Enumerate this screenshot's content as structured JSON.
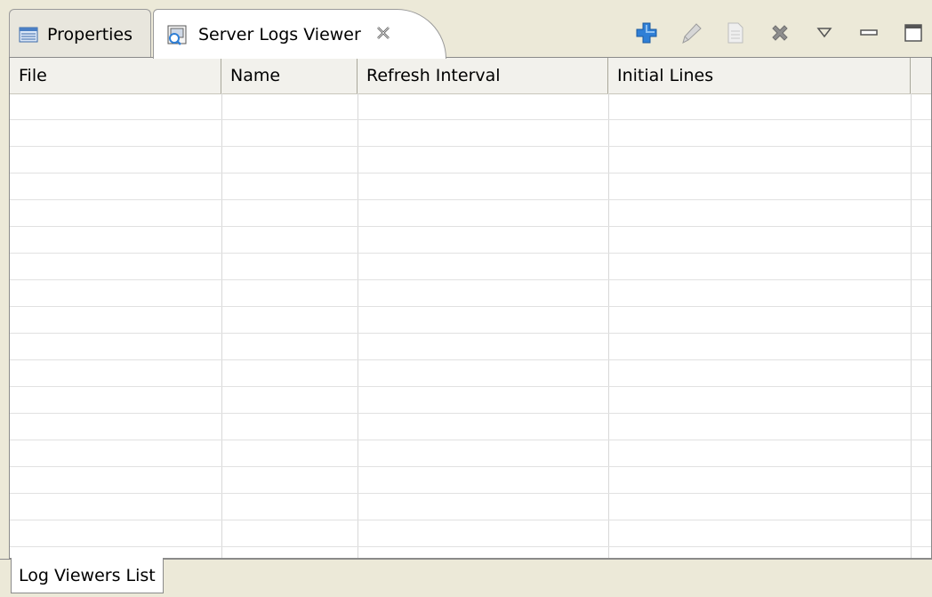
{
  "tabs": {
    "properties": "Properties",
    "active": "Server Logs Viewer"
  },
  "icons": {
    "properties": "properties-icon",
    "server_logs": "server-logs-icon",
    "close": "close-icon",
    "add": "add-icon",
    "edit": "edit-icon",
    "copy": "copy-icon",
    "delete": "delete-icon",
    "view_menu": "view-menu-icon",
    "minimize": "minimize-icon",
    "maximize": "maximize-icon"
  },
  "colors": {
    "accent_blue": "#2f7fd6",
    "toolbar_gray": "#8a8a8a",
    "background": "#ece9d8"
  },
  "table": {
    "columns": [
      "File",
      "Name",
      "Refresh Interval",
      "Initial Lines",
      ""
    ],
    "rows": []
  },
  "bottom_tabs": [
    "Log Viewers List"
  ]
}
